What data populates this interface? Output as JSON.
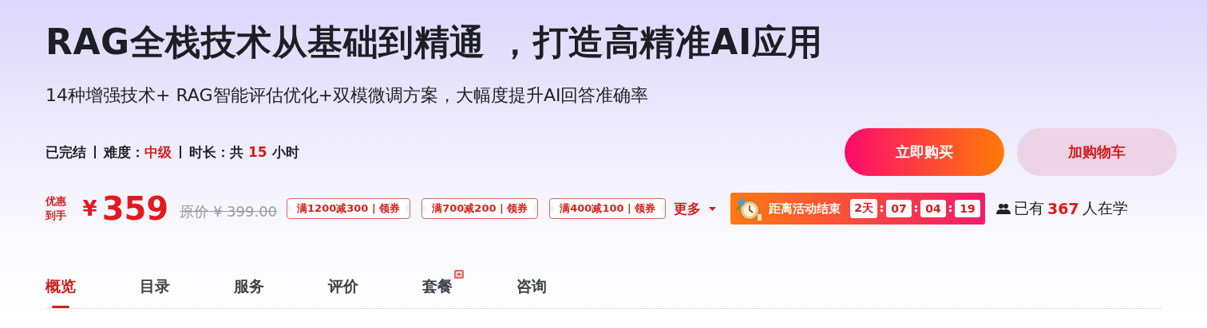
{
  "title": "RAG全栈技术从基础到精通 ，打造高精准AI应用",
  "subtitle": "14种增强技术+ RAG智能评估优化+双模微调方案，大幅度提升AI回答准确率",
  "meta": {
    "status": "已完结",
    "difficulty_label": "难度：",
    "difficulty": "中级",
    "duration_label": "时长：共",
    "duration": "15",
    "duration_unit": "小时"
  },
  "buttons": [
    {
      "label": "立即购买",
      "kind": "primary"
    },
    {
      "label": "加购物车",
      "kind": "secondary"
    }
  ],
  "price": {
    "label": "优惠到手",
    "currency": "¥",
    "value": "359",
    "original": "原价 ¥ 399.00"
  },
  "coupons": [
    {
      "label": "满1200减300 | 领券"
    },
    {
      "label": "满700减200 | 领券"
    },
    {
      "label": "满400减100 | 领券"
    }
  ],
  "more": "更多",
  "countdown": {
    "label": "距离活动结束",
    "days": "2天",
    "hours": "07",
    "minutes": "04",
    "seconds": "19"
  },
  "learners": {
    "prefix": "已有",
    "count": "367",
    "suffix": "人在学"
  },
  "tabs": [
    {
      "label": "概览",
      "selected": true,
      "badge": false
    },
    {
      "label": "目录",
      "selected": false,
      "badge": false
    },
    {
      "label": "服务",
      "selected": false,
      "badge": false
    },
    {
      "label": "评价",
      "selected": false,
      "badge": false
    },
    {
      "label": "套餐",
      "selected": false,
      "badge": true
    },
    {
      "label": "咨询",
      "selected": false,
      "badge": false
    }
  ]
}
